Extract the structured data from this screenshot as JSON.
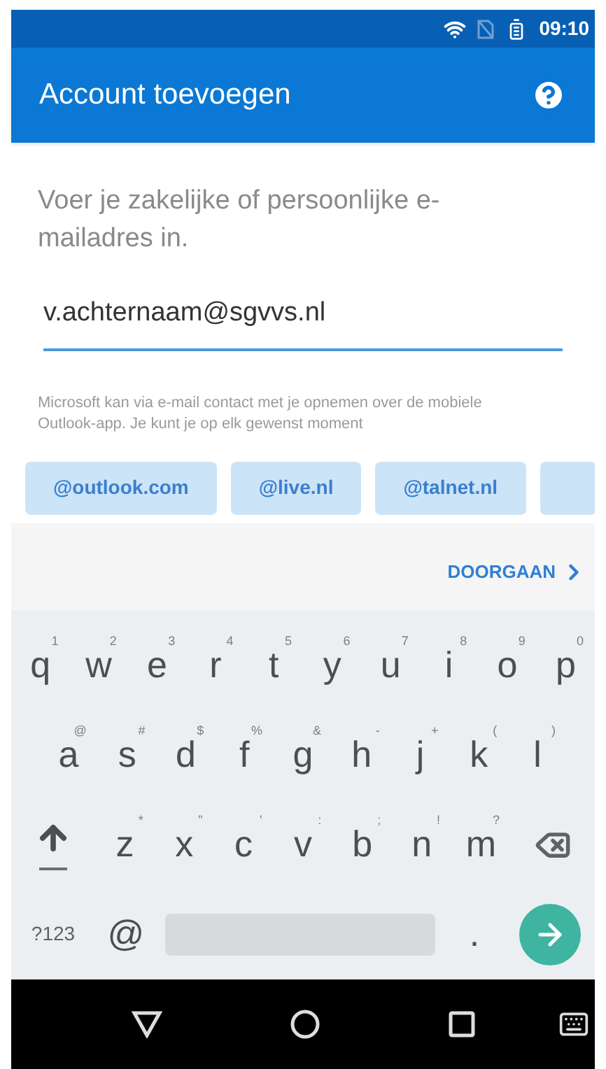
{
  "status_bar": {
    "time": "09:10"
  },
  "app_bar": {
    "title": "Account toevoegen"
  },
  "intro": "Voer je zakelijke of persoonlijke e-mailadres in.",
  "email": {
    "value": "v.achternaam@sgvvs.nl"
  },
  "disclaimer": "Microsoft kan via e-mail contact met je opnemen over de mobiele Outlook-app. Je kunt je op elk gewenst moment",
  "suggestions": [
    {
      "label": "@outlook.com"
    },
    {
      "label": "@live.nl"
    },
    {
      "label": "@talnet.nl"
    }
  ],
  "suggestions_overflow": true,
  "continue_button": {
    "label": "DOORGAAN"
  },
  "keyboard": {
    "rows": [
      [
        {
          "kind": "letter",
          "label": "q",
          "hint": "1"
        },
        {
          "kind": "letter",
          "label": "w",
          "hint": "2"
        },
        {
          "kind": "letter",
          "label": "e",
          "hint": "3"
        },
        {
          "kind": "letter",
          "label": "r",
          "hint": "4"
        },
        {
          "kind": "letter",
          "label": "t",
          "hint": "5"
        },
        {
          "kind": "letter",
          "label": "y",
          "hint": "6"
        },
        {
          "kind": "letter",
          "label": "u",
          "hint": "7"
        },
        {
          "kind": "letter",
          "label": "i",
          "hint": "8"
        },
        {
          "kind": "letter",
          "label": "o",
          "hint": "9"
        },
        {
          "kind": "letter",
          "label": "p",
          "hint": "0"
        }
      ],
      [
        {
          "kind": "letter",
          "label": "a",
          "hint": "@"
        },
        {
          "kind": "letter",
          "label": "s",
          "hint": "#"
        },
        {
          "kind": "letter",
          "label": "d",
          "hint": "$"
        },
        {
          "kind": "letter",
          "label": "f",
          "hint": "%"
        },
        {
          "kind": "letter",
          "label": "g",
          "hint": "&"
        },
        {
          "kind": "letter",
          "label": "h",
          "hint": "-"
        },
        {
          "kind": "letter",
          "label": "j",
          "hint": "+"
        },
        {
          "kind": "letter",
          "label": "k",
          "hint": "("
        },
        {
          "kind": "letter",
          "label": "l",
          "hint": ")"
        }
      ],
      [
        {
          "kind": "shift"
        },
        {
          "kind": "letter",
          "label": "z",
          "hint": "*"
        },
        {
          "kind": "letter",
          "label": "x",
          "hint": "\""
        },
        {
          "kind": "letter",
          "label": "c",
          "hint": "'"
        },
        {
          "kind": "letter",
          "label": "v",
          "hint": ":"
        },
        {
          "kind": "letter",
          "label": "b",
          "hint": ";"
        },
        {
          "kind": "letter",
          "label": "n",
          "hint": "!"
        },
        {
          "kind": "letter",
          "label": "m",
          "hint": "?"
        },
        {
          "kind": "backspace"
        }
      ]
    ],
    "bottom_row": [
      {
        "kind": "text",
        "label": "?123"
      },
      {
        "kind": "symbol",
        "label": "@"
      },
      {
        "kind": "space"
      },
      {
        "kind": "symbol",
        "label": "."
      },
      {
        "kind": "enter"
      }
    ]
  }
}
